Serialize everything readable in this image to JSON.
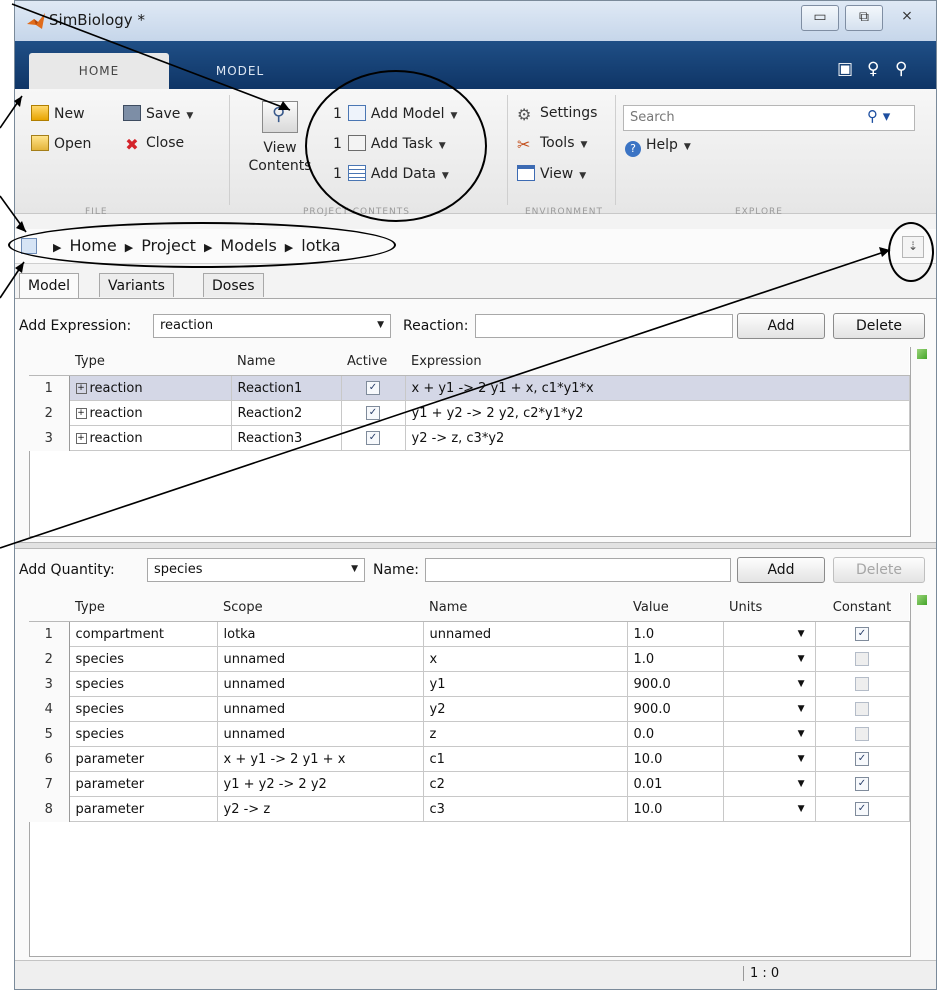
{
  "window": {
    "title": "SimBiology *",
    "minimize": "▭",
    "maximize": "⧉",
    "close": "⨯"
  },
  "tabs": [
    {
      "label": "HOME"
    },
    {
      "label": "MODEL"
    }
  ],
  "ribbon": {
    "file": {
      "new": "New",
      "save": "Save",
      "open": "Open",
      "close": "Close",
      "group_label": "FILE"
    },
    "view_contents": "View Contents",
    "project_contents": {
      "add_model": "Add Model",
      "add_task": "Add Task",
      "add_data": "Add Data",
      "number": "1",
      "group_label": "PROJECT CONTENTS"
    },
    "environment": {
      "settings": "Settings",
      "tools": "Tools",
      "view": "View",
      "group_label": "ENVIRONMENT"
    },
    "explore": {
      "search_placeholder": "Search",
      "help": "Help",
      "group_label": "EXPLORE"
    }
  },
  "breadcrumb": [
    "Home",
    "Project",
    "Models",
    "lotka"
  ],
  "subtabs": [
    "Model",
    "Variants",
    "Doses"
  ],
  "reactions_panel": {
    "add_expression_label": "Add Expression:",
    "expression_type": "reaction",
    "reaction_label": "Reaction:",
    "add_button": "Add",
    "delete_button": "Delete",
    "headers": [
      "Type",
      "Name",
      "Active",
      "Expression"
    ],
    "rows": [
      {
        "num": "1",
        "type": "reaction",
        "name": "Reaction1",
        "active": true,
        "expression": "x + y1 -> 2 y1 + x, c1*y1*x"
      },
      {
        "num": "2",
        "type": "reaction",
        "name": "Reaction2",
        "active": true,
        "expression": "y1 + y2 -> 2 y2, c2*y1*y2"
      },
      {
        "num": "3",
        "type": "reaction",
        "name": "Reaction3",
        "active": true,
        "expression": "y2 -> z, c3*y2"
      }
    ]
  },
  "quantity_panel": {
    "add_quantity_label": "Add Quantity:",
    "quantity_type": "species",
    "name_label": "Name:",
    "add_button": "Add",
    "delete_button": "Delete",
    "headers": [
      "Type",
      "Scope",
      "Name",
      "Value",
      "Units",
      "Constant"
    ],
    "rows": [
      {
        "num": "1",
        "type": "compartment",
        "scope": "lotka",
        "name": "unnamed",
        "value": "1.0",
        "constant": true
      },
      {
        "num": "2",
        "type": "species",
        "scope": "unnamed",
        "name": "x",
        "value": "1.0",
        "constant": false
      },
      {
        "num": "3",
        "type": "species",
        "scope": "unnamed",
        "name": "y1",
        "value": "900.0",
        "constant": false
      },
      {
        "num": "4",
        "type": "species",
        "scope": "unnamed",
        "name": "y2",
        "value": "900.0",
        "constant": false
      },
      {
        "num": "5",
        "type": "species",
        "scope": "unnamed",
        "name": "z",
        "value": "0.0",
        "constant": false
      },
      {
        "num": "6",
        "type": "parameter",
        "scope": "x + y1 -> 2 y1 + x",
        "name": "c1",
        "value": "10.0",
        "constant": true
      },
      {
        "num": "7",
        "type": "parameter",
        "scope": "y1 + y2 -> 2 y2",
        "name": "c2",
        "value": "0.01",
        "constant": true
      },
      {
        "num": "8",
        "type": "parameter",
        "scope": "y2 -> z",
        "name": "c3",
        "value": "10.0",
        "constant": true
      }
    ]
  },
  "status": {
    "position": "1 : 0"
  },
  "colors": {
    "ribbon_tab_bar": "#1f4f86",
    "selection": "#d4d7e6",
    "accent_green": "#44a52a"
  }
}
